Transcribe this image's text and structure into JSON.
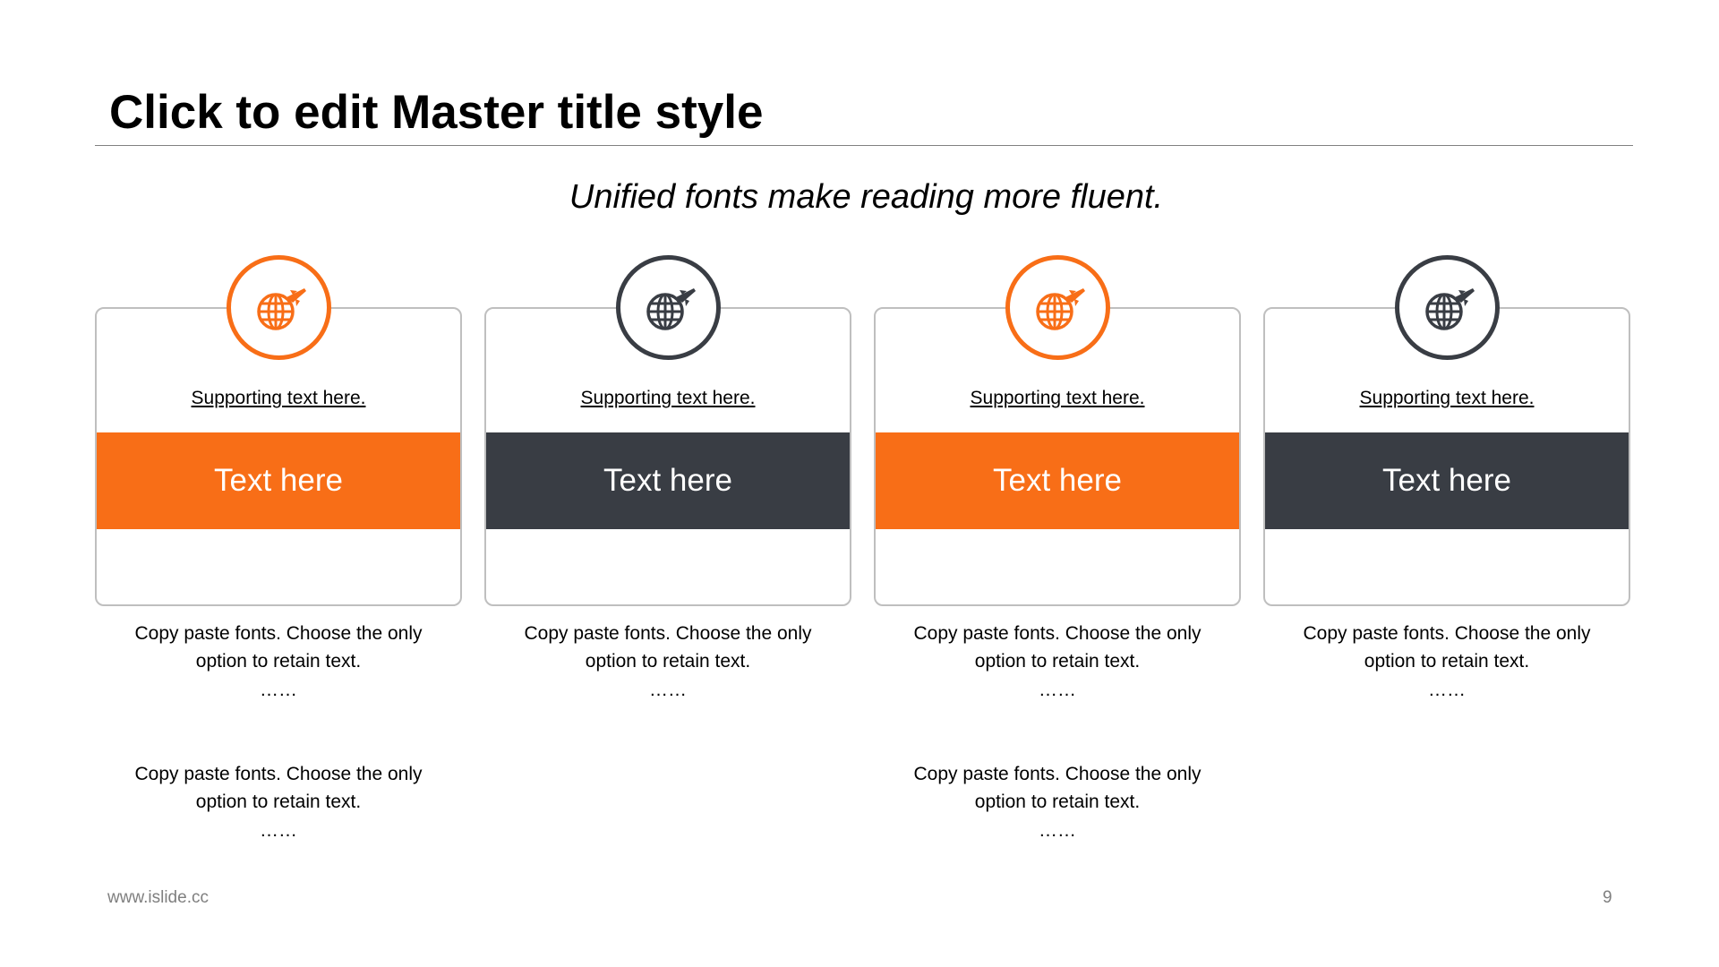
{
  "title": "Click to edit Master title style",
  "subtitle": "Unified fonts make reading more fluent.",
  "colors": {
    "orange": "#F86E17",
    "dark": "#393D44"
  },
  "cards": [
    {
      "icon": "globe-plane-icon",
      "color": "orange",
      "support": "Supporting text here.",
      "label": "Text here"
    },
    {
      "icon": "globe-plane-icon",
      "color": "dark",
      "support": "Supporting text here.",
      "label": "Text here"
    },
    {
      "icon": "globe-plane-icon",
      "color": "orange",
      "support": "Supporting text here.",
      "label": "Text here"
    },
    {
      "icon": "globe-plane-icon",
      "color": "dark",
      "support": "Supporting text here.",
      "label": "Text here"
    }
  ],
  "notes": {
    "col1_top": {
      "line1": "Copy paste fonts. Choose the only",
      "line2": "option to retain text.",
      "dots": "……"
    },
    "col2_top": {
      "line1": "Copy paste fonts. Choose the only",
      "line2": "option to retain text.",
      "dots": "……"
    },
    "col3_top": {
      "line1": "Copy paste fonts. Choose the only",
      "line2": "option to retain text.",
      "dots": "……"
    },
    "col4_top": {
      "line1": "Copy paste fonts. Choose the only",
      "line2": "option to retain text.",
      "dots": "……"
    },
    "col1_bottom": {
      "line1": "Copy paste fonts. Choose the only",
      "line2": "option to retain text.",
      "dots": "……"
    },
    "col3_bottom": {
      "line1": "Copy paste fonts. Choose the only",
      "line2": "option to retain text.",
      "dots": "……"
    }
  },
  "footer": {
    "website": "www.islide.cc",
    "page_number": "9"
  }
}
